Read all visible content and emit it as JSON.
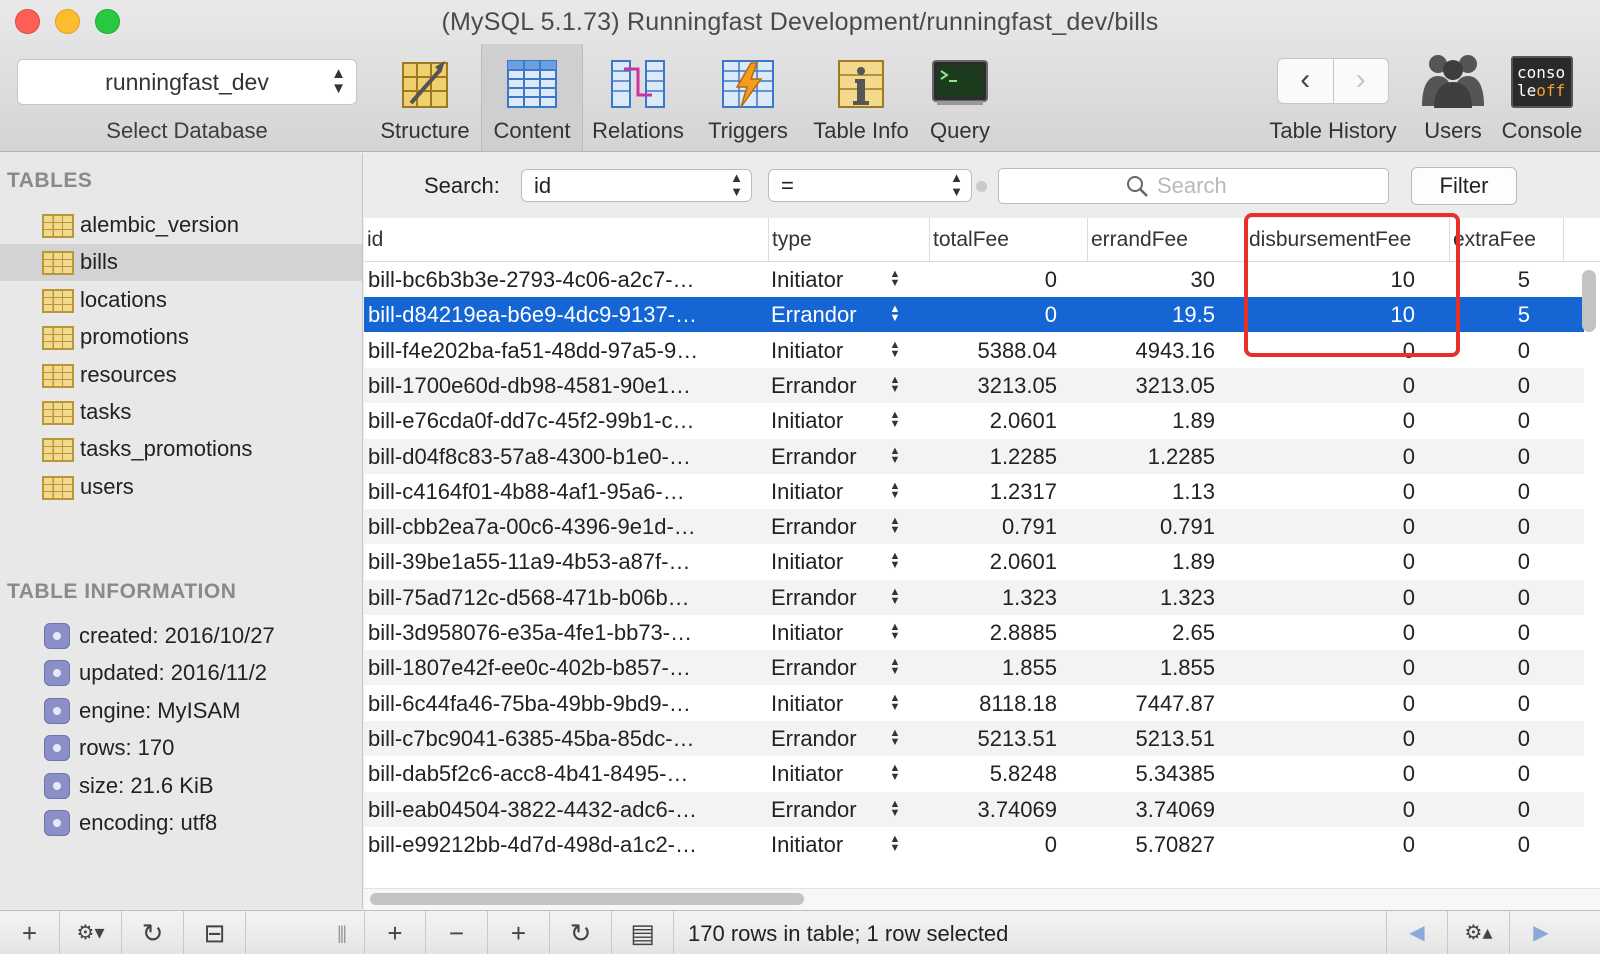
{
  "window": {
    "title": "(MySQL 5.1.73) Runningfast Development/runningfast_dev/bills"
  },
  "toolbar": {
    "database": "runningfast_dev",
    "database_caption": "Select Database",
    "buttons": [
      "Structure",
      "Content",
      "Relations",
      "Triggers",
      "Table Info",
      "Query"
    ],
    "active": "Content",
    "history_label": "Table History",
    "back_glyph": "‹",
    "forward_glyph": "›",
    "users_label": "Users",
    "console_label": "Console",
    "console_icon_text": [
      "conso",
      "le",
      "off"
    ]
  },
  "sidebar": {
    "tables_heading": "TABLES",
    "tables": [
      "alembic_version",
      "bills",
      "locations",
      "promotions",
      "resources",
      "tasks",
      "tasks_promotions",
      "users"
    ],
    "selected_table": "bills",
    "info_heading": "TABLE INFORMATION",
    "info": [
      "created: 2016/10/27",
      "updated: 2016/11/2",
      "engine: MyISAM",
      "rows: 170",
      "size: 21.6 KiB",
      "encoding: utf8"
    ]
  },
  "filter": {
    "search_label": "Search:",
    "field": "id",
    "operator": "=",
    "placeholder": "Search",
    "button": "Filter"
  },
  "grid": {
    "columns": [
      "id",
      "type",
      "totalFee",
      "errandFee",
      "disbursementFee",
      "extraFee"
    ],
    "rows": [
      [
        "bill-bc6b3b3e-2793-4c06-a2c7-…",
        "Initiator",
        "0",
        "30",
        "10",
        "5"
      ],
      [
        "bill-d84219ea-b6e9-4dc9-9137-…",
        "Errandor",
        "0",
        "19.5",
        "10",
        "5"
      ],
      [
        "bill-f4e202ba-fa51-48dd-97a5-9…",
        "Initiator",
        "5388.04",
        "4943.16",
        "0",
        "0"
      ],
      [
        "bill-1700e60d-db98-4581-90e1…",
        "Errandor",
        "3213.05",
        "3213.05",
        "0",
        "0"
      ],
      [
        "bill-e76cda0f-dd7c-45f2-99b1-c…",
        "Initiator",
        "2.0601",
        "1.89",
        "0",
        "0"
      ],
      [
        "bill-d04f8c83-57a8-4300-b1e0-…",
        "Errandor",
        "1.2285",
        "1.2285",
        "0",
        "0"
      ],
      [
        "bill-c4164f01-4b88-4af1-95a6-…",
        "Initiator",
        "1.2317",
        "1.13",
        "0",
        "0"
      ],
      [
        "bill-cbb2ea7a-00c6-4396-9e1d-…",
        "Errandor",
        "0.791",
        "0.791",
        "0",
        "0"
      ],
      [
        "bill-39be1a55-11a9-4b53-a87f-…",
        "Initiator",
        "2.0601",
        "1.89",
        "0",
        "0"
      ],
      [
        "bill-75ad712c-d568-471b-b06b…",
        "Errandor",
        "1.323",
        "1.323",
        "0",
        "0"
      ],
      [
        "bill-3d958076-e35a-4fe1-bb73-…",
        "Initiator",
        "2.8885",
        "2.65",
        "0",
        "0"
      ],
      [
        "bill-1807e42f-ee0c-402b-b857-…",
        "Errandor",
        "1.855",
        "1.855",
        "0",
        "0"
      ],
      [
        "bill-6c44fa46-75ba-49bb-9bd9-…",
        "Initiator",
        "8118.18",
        "7447.87",
        "0",
        "0"
      ],
      [
        "bill-c7bc9041-6385-45ba-85dc-…",
        "Errandor",
        "5213.51",
        "5213.51",
        "0",
        "0"
      ],
      [
        "bill-dab5f2c6-acc8-4b41-8495-…",
        "Initiator",
        "5.8248",
        "5.34385",
        "0",
        "0"
      ],
      [
        "bill-eab04504-3822-4432-adc6-…",
        "Errandor",
        "3.74069",
        "3.74069",
        "0",
        "0"
      ],
      [
        "bill-e99212bb-4d7d-498d-a1c2-…",
        "Initiator",
        "0",
        "5.70827",
        "0",
        "0"
      ]
    ],
    "selected_row_index": 1,
    "highlighted_column": "disbursementFee"
  },
  "bottombar": {
    "status": "170 rows in table; 1 row selected",
    "left_buttons": [
      "+",
      "⚙▾",
      "↻",
      "⊟"
    ],
    "grid_buttons": [
      "+",
      "−",
      "+",
      "↻",
      "▤"
    ],
    "right_buttons": [
      "◀",
      "⚙▴",
      "▶"
    ]
  },
  "colors": {
    "selection": "#1566d4",
    "highlight_box": "#e8302a"
  }
}
